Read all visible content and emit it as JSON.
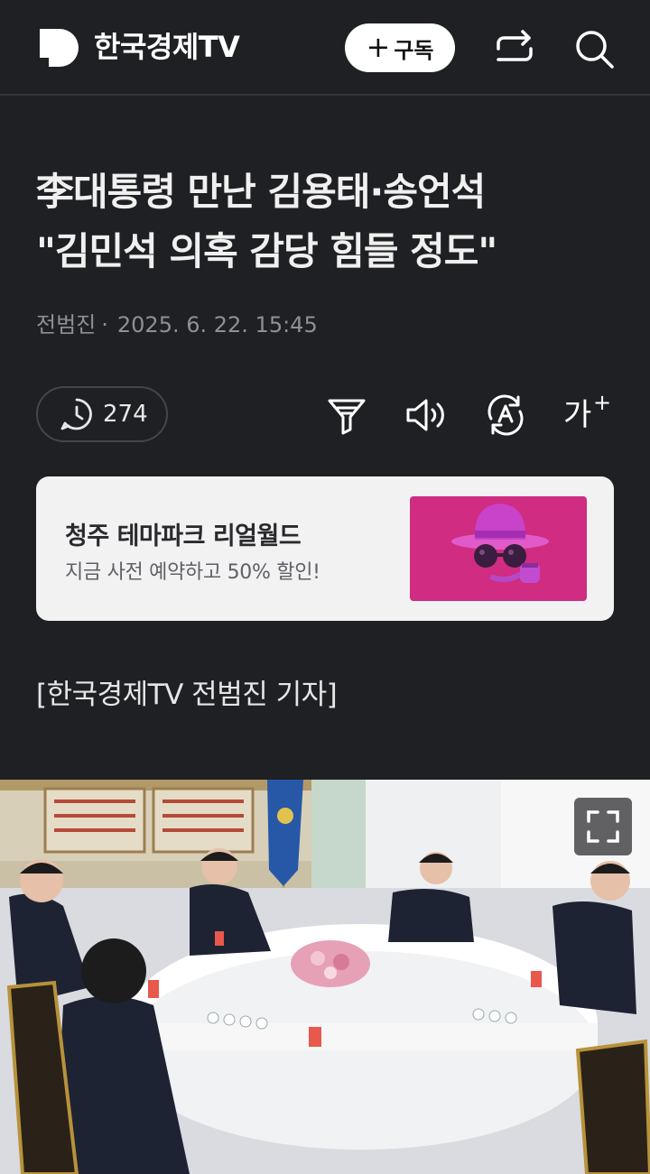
{
  "header": {
    "brand_initial": "D",
    "brand_name": "한국경제TV",
    "subscribe_label": "구독",
    "share_icon": "share-icon",
    "search_icon": "search-icon"
  },
  "article": {
    "headline_line1": "李대통령 만난 김용태·송언석",
    "headline_line2": "\"김민석 의혹 감당 힘들 정도\"",
    "author": "전범진",
    "separator": "·",
    "datetime": "2025. 6. 22. 15:45",
    "comment_count": "274",
    "reporter_tag": "[한국경제TV 전범진 기자]"
  },
  "toolbar": {
    "icons": [
      "filter-icon",
      "speaker-icon",
      "translate-icon",
      "font-size-icon"
    ],
    "font_size_label": "가"
  },
  "ad": {
    "title": "청주 테마파크 리얼월드",
    "subtitle": "지금 사전 예약하고 50% 할인!",
    "image_bg": "#cf2c82"
  },
  "photo": {
    "expand_icon": "fullscreen-icon"
  },
  "colors": {
    "background": "#1f2024",
    "ad_background": "#f2f2f3",
    "muted_text": "#8e9096"
  }
}
